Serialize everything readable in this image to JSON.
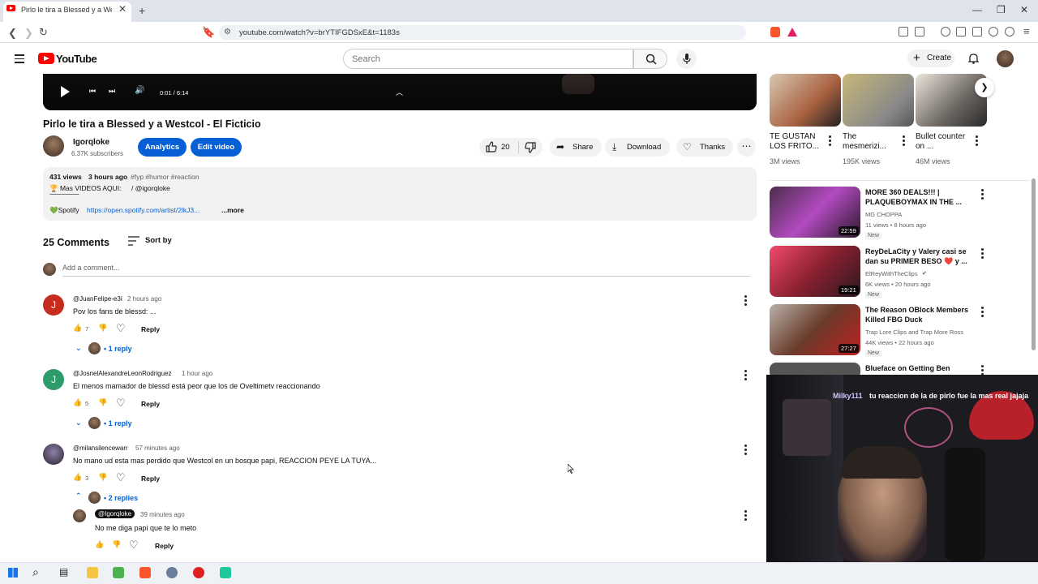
{
  "browser": {
    "tab_title": "Pirlo le tira a Blessed y a Westco",
    "url": "youtube.com/watch?v=brYTIFGDSxE&t=1183s"
  },
  "youtube": {
    "logo_text": "YouTube",
    "search_placeholder": "Search",
    "create_label": "Create"
  },
  "video": {
    "time": "0:01 / 6:14",
    "title": "Pirlo le tira a Blessed y a Westcol - El Ficticio",
    "channel": "Igorqloke",
    "subscribers": "6.37K subscribers",
    "analytics_label": "Analytics",
    "edit_label": "Edit video",
    "likes": "20",
    "share_label": "Share",
    "download_label": "Download",
    "thanks_label": "Thanks",
    "views": "431 views",
    "posted": "3 hours ago",
    "hashtags": "#fyp #humor #reaction",
    "desc_line1": "🏆 Mas VIDEOS AQUI:",
    "desc_line1b": "/ @igorqloke",
    "desc_divider": "------------------------------------",
    "desc_spotify": "💚Spotify",
    "desc_link": "https://open.spotify.com/artist/2lkJ3...",
    "more_label": "...more"
  },
  "comments": {
    "count_label": "25 Comments",
    "sort_label": "Sort by",
    "add_placeholder": "Add a comment...",
    "reply_label": "Reply",
    "items": [
      {
        "initial": "J",
        "color": "#c62d1f",
        "handle": "@JuanFelipe-e3i",
        "ago": "2 hours ago",
        "text": "Pov los fans de blessd: ...",
        "likes": "7",
        "replies": "1 reply"
      },
      {
        "initial": "J",
        "color": "#2e9c6a",
        "handle": "@JosnelAlexandreLeonRodriguez",
        "ago": "1 hour ago",
        "text": "El menos mamador de blessd está peor que los de Oveltimetv reaccionando",
        "likes": "5",
        "replies": "1 reply"
      },
      {
        "initial": "",
        "color": "#5b4d6e",
        "handle": "@milansilencewarr",
        "ago": "57 minutes ago",
        "text": "No mano ud esta mas perdido que Westcol en un bosque papi, REACCION PEYE LA TUYA...",
        "likes": "3",
        "replies": "2 replies"
      }
    ],
    "nested": {
      "handle": "@Igorqloke",
      "ago": "39 minutes ago",
      "text": "No me diga papi que te lo meto"
    }
  },
  "sidebar": {
    "top_row": [
      {
        "title": "TE GUSTAN LOS FRITO...",
        "views": "3M views"
      },
      {
        "title": "The mesmerizi...",
        "views": "195K views"
      },
      {
        "title": "Bullet counter on ...",
        "views": "46M views"
      }
    ],
    "items": [
      {
        "title": "MORE 360 DEALS!!! | PLAQUEBOYMAX IN THE ...",
        "channel": "MG CHOPPA",
        "meta": "11 views • 8 hours ago",
        "badge": "New",
        "duration": "22:59",
        "thumb": "#6a3f6e"
      },
      {
        "title": "ReyDeLaCity y Valery casi se dan su PRIMER BESO ❤️ y ...",
        "channel": "ElReyWithTheClips",
        "meta": "6K views • 20 hours ago",
        "badge": "New",
        "duration": "19:21",
        "thumb": "#c43a4e"
      },
      {
        "title": "The Reason OBlock Members Killed FBG Duck",
        "channel": "Trap Lore Clips and Trap More Ross",
        "meta": "44K views • 22 hours ago",
        "badge": "New",
        "duration": "27:27",
        "thumb": "#7a4a3a"
      },
      {
        "title": "Blueface on Getting Ben",
        "channel": "",
        "meta": "",
        "badge": "",
        "duration": "",
        "thumb": "#333333"
      }
    ]
  },
  "stream": {
    "chat_user": "Milky111",
    "chat_text": "tu reaccion de la de pirlo fue la mas real jajaja"
  }
}
